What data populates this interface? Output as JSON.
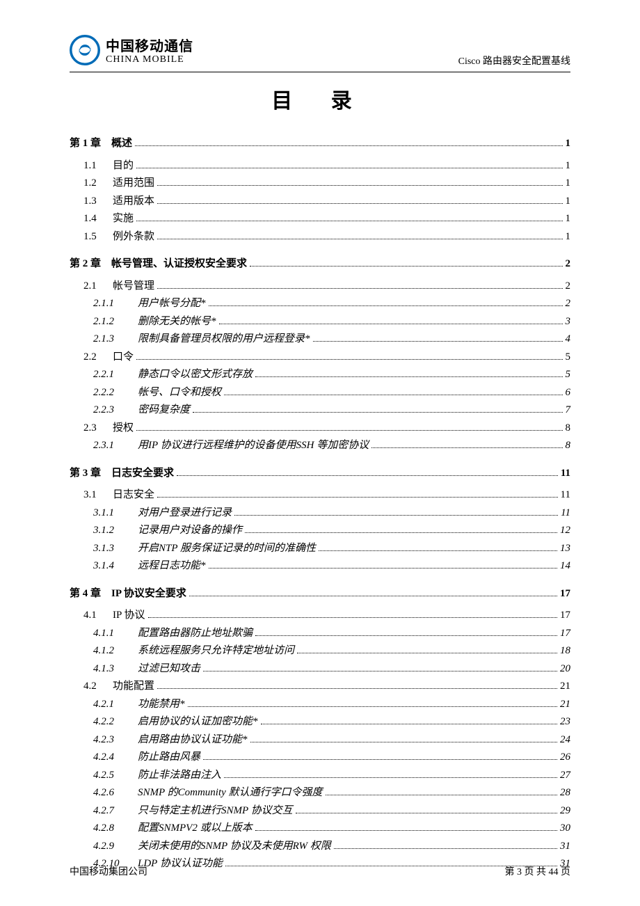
{
  "header": {
    "logo_cn": "中国移动通信",
    "logo_en": "CHINA MOBILE",
    "doc_title": "Cisco 路由器安全配置基线"
  },
  "toc_title": "目  录",
  "toc": [
    {
      "level": "chapter",
      "num": "第 1 章",
      "label": "概述",
      "page": "1"
    },
    {
      "level": "section",
      "num": "1.1",
      "label": "目的",
      "page": "1"
    },
    {
      "level": "section",
      "num": "1.2",
      "label": "适用范围",
      "page": "1"
    },
    {
      "level": "section",
      "num": "1.3",
      "label": "适用版本",
      "page": "1"
    },
    {
      "level": "section",
      "num": "1.4",
      "label": "实施",
      "page": "1"
    },
    {
      "level": "section",
      "num": "1.5",
      "label": "例外条款",
      "page": "1"
    },
    {
      "level": "chapter",
      "num": "第 2 章",
      "label": "帐号管理、认证授权安全要求",
      "page": "2"
    },
    {
      "level": "section",
      "num": "2.1",
      "label": "帐号管理",
      "page": "2"
    },
    {
      "level": "sub",
      "num": "2.1.1",
      "label": "用户帐号分配*",
      "page": "2"
    },
    {
      "level": "sub",
      "num": "2.1.2",
      "label": "删除无关的帐号*",
      "page": "3"
    },
    {
      "level": "sub",
      "num": "2.1.3",
      "label": "限制具备管理员权限的用户远程登录*",
      "page": "4"
    },
    {
      "level": "section",
      "num": "2.2",
      "label": "口令",
      "page": "5"
    },
    {
      "level": "sub",
      "num": "2.2.1",
      "label": "静态口令以密文形式存放",
      "page": "5"
    },
    {
      "level": "sub",
      "num": "2.2.2",
      "label": "帐号、口令和授权",
      "page": "6"
    },
    {
      "level": "sub",
      "num": "2.2.3",
      "label": "密码复杂度",
      "page": "7"
    },
    {
      "level": "section",
      "num": "2.3",
      "label": "授权",
      "page": "8"
    },
    {
      "level": "sub",
      "num": "2.3.1",
      "label": "用IP 协议进行远程维护的设备使用SSH 等加密协议",
      "page": "8"
    },
    {
      "level": "chapter",
      "num": "第 3 章",
      "label": "日志安全要求",
      "page": "11"
    },
    {
      "level": "section",
      "num": "3.1",
      "label": "日志安全",
      "page": "11"
    },
    {
      "level": "sub",
      "num": "3.1.1",
      "label": "对用户登录进行记录",
      "page": "11"
    },
    {
      "level": "sub",
      "num": "3.1.2",
      "label": "记录用户对设备的操作",
      "page": "12"
    },
    {
      "level": "sub",
      "num": "3.1.3",
      "label": "开启NTP 服务保证记录的时间的准确性",
      "page": "13"
    },
    {
      "level": "sub",
      "num": "3.1.4",
      "label": "远程日志功能*",
      "page": "14"
    },
    {
      "level": "chapter",
      "num": "第 4 章",
      "label": "IP 协议安全要求",
      "page": "17"
    },
    {
      "level": "section",
      "num": "4.1",
      "label": "IP 协议",
      "page": "17"
    },
    {
      "level": "sub",
      "num": "4.1.1",
      "label": "配置路由器防止地址欺骗",
      "page": "17"
    },
    {
      "level": "sub",
      "num": "4.1.2",
      "label": "系统远程服务只允许特定地址访问",
      "page": "18"
    },
    {
      "level": "sub",
      "num": "4.1.3",
      "label": "过滤已知攻击",
      "page": "20"
    },
    {
      "level": "section",
      "num": "4.2",
      "label": "功能配置",
      "page": "21"
    },
    {
      "level": "sub",
      "num": "4.2.1",
      "label": "功能禁用*",
      "page": "21"
    },
    {
      "level": "sub",
      "num": "4.2.2",
      "label": "启用协议的认证加密功能*",
      "page": "23"
    },
    {
      "level": "sub",
      "num": "4.2.3",
      "label": "启用路由协议认证功能*",
      "page": "24"
    },
    {
      "level": "sub",
      "num": "4.2.4",
      "label": "防止路由风暴",
      "page": "26"
    },
    {
      "level": "sub",
      "num": "4.2.5",
      "label": "防止非法路由注入",
      "page": "27"
    },
    {
      "level": "sub",
      "num": "4.2.6",
      "label": "SNMP 的Community 默认通行字口令强度",
      "page": "28"
    },
    {
      "level": "sub",
      "num": "4.2.7",
      "label": "只与特定主机进行SNMP 协议交互",
      "page": "29"
    },
    {
      "level": "sub",
      "num": "4.2.8",
      "label": "配置SNMPV2 或以上版本",
      "page": "30"
    },
    {
      "level": "sub",
      "num": "4.2.9",
      "label": "关闭未使用的SNMP 协议及未使用RW 权限",
      "page": "31"
    },
    {
      "level": "sub",
      "num": "4.2.10",
      "label": "LDP 协议认证功能",
      "page": "31"
    }
  ],
  "footer": {
    "left": "中国移动集团公司",
    "right": "第 3 页 共 44 页"
  }
}
